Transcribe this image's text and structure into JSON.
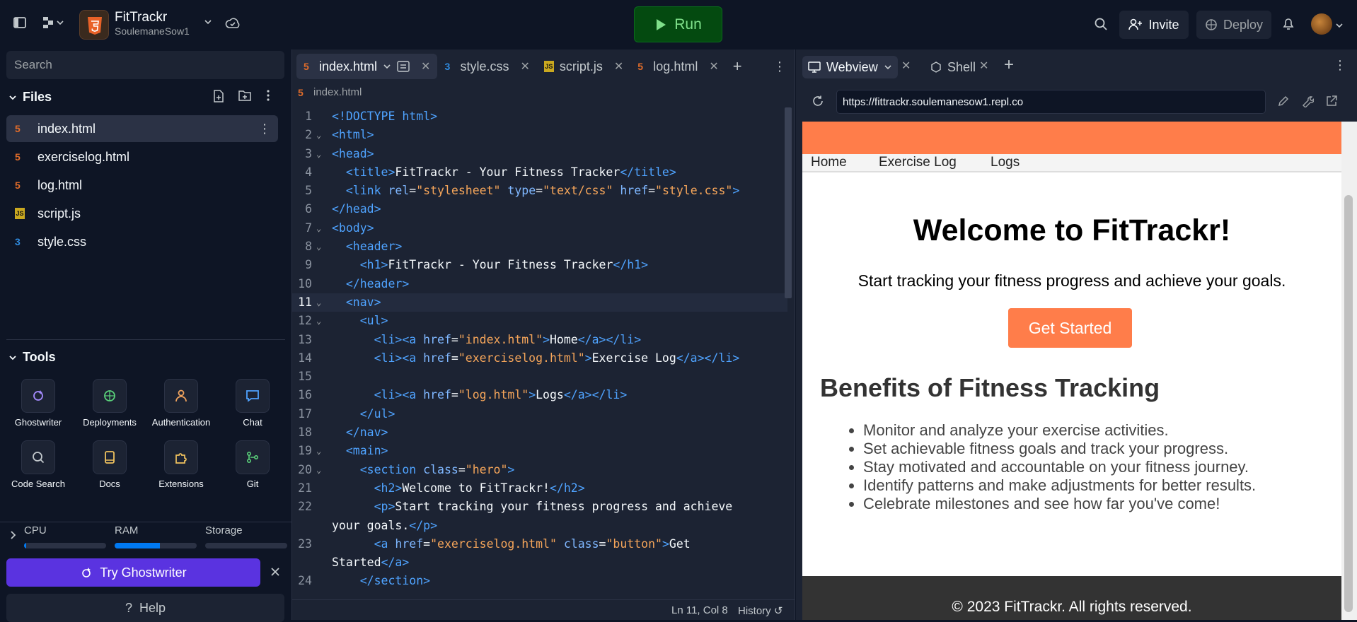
{
  "topbar": {
    "app_name": "FitTrackr",
    "owner": "SoulemaneSow1",
    "run_label": "Run",
    "invite_label": "Invite",
    "deploy_label": "Deploy"
  },
  "sidebar": {
    "search_placeholder": "Search",
    "files_heading": "Files",
    "files": [
      {
        "name": "index.html",
        "type": "html"
      },
      {
        "name": "exerciselog.html",
        "type": "html"
      },
      {
        "name": "log.html",
        "type": "html"
      },
      {
        "name": "script.js",
        "type": "js"
      },
      {
        "name": "style.css",
        "type": "css"
      }
    ],
    "tools_heading": "Tools",
    "tools": [
      "Ghostwriter",
      "Deployments",
      "Authentication",
      "Chat",
      "Code Search",
      "Docs",
      "Extensions",
      "Git"
    ],
    "resources": {
      "cpu_label": "CPU",
      "ram_label": "RAM",
      "storage_label": "Storage",
      "cpu_usage": 0.03,
      "ram_usage": 0.55,
      "storage_usage": 0.0
    },
    "ghostwriter_button": "Try Ghostwriter",
    "help_button": "Help"
  },
  "editor": {
    "tabs": [
      {
        "label": "index.html",
        "type": "html",
        "active": true
      },
      {
        "label": "style.css",
        "type": "css",
        "active": false
      },
      {
        "label": "script.js",
        "type": "js",
        "active": false
      },
      {
        "label": "log.html",
        "type": "html",
        "active": false
      }
    ],
    "breadcrumb": "index.html",
    "status_position": "Ln 11, Col 8",
    "history_label": "History"
  },
  "webview": {
    "tab_webview": "Webview",
    "tab_shell": "Shell",
    "url": "https://fittrackr.soulemanesow1.repl.co",
    "nav": [
      "Home",
      "Exercise Log",
      "Logs"
    ],
    "hero_title": "Welcome to FitTrackr!",
    "hero_text": "Start tracking your fitness progress and achieve your goals.",
    "hero_button": "Get Started",
    "benefits_title": "Benefits of Fitness Tracking",
    "benefits": [
      "Monitor and analyze your exercise activities.",
      "Set achievable fitness goals and track your progress.",
      "Stay motivated and accountable on your fitness journey.",
      "Identify patterns and make adjustments for better results.",
      "Celebrate milestones and see how far you've come!"
    ],
    "footer": "© 2023 FitTrackr. All rights reserved."
  },
  "colors": {
    "accent_orange": "#ff7d4a",
    "run_green": "#044a10",
    "ghostwriter_purple": "#5a33e0"
  }
}
